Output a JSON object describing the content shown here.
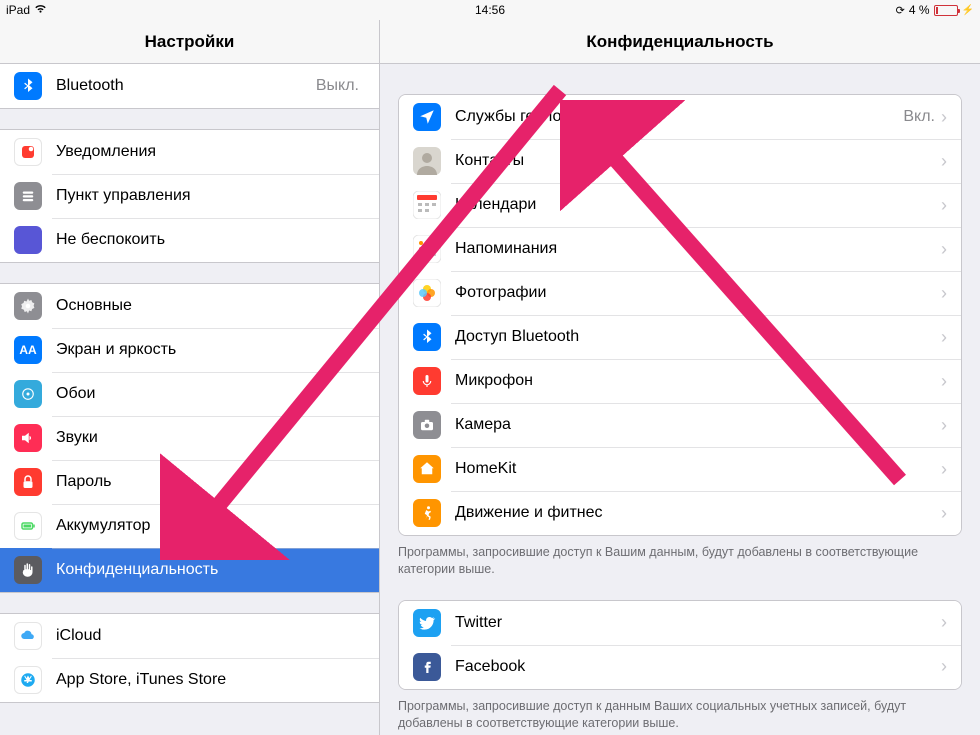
{
  "statusbar": {
    "device": "iPad",
    "time": "14:56",
    "battery_percent": "4 %"
  },
  "sidebar": {
    "title": "Настройки",
    "groups": [
      [
        {
          "id": "bluetooth",
          "label": "Bluetooth",
          "value": "Выкл."
        }
      ],
      [
        {
          "id": "notifications",
          "label": "Уведомления"
        },
        {
          "id": "control-center",
          "label": "Пункт управления"
        },
        {
          "id": "do-not-disturb",
          "label": "Не беспокоить"
        }
      ],
      [
        {
          "id": "general",
          "label": "Основные"
        },
        {
          "id": "display",
          "label": "Экран и яркость"
        },
        {
          "id": "wallpaper",
          "label": "Обои"
        },
        {
          "id": "sounds",
          "label": "Звуки"
        },
        {
          "id": "passcode",
          "label": "Пароль"
        },
        {
          "id": "battery",
          "label": "Аккумулятор"
        },
        {
          "id": "privacy",
          "label": "Конфиденциальность",
          "selected": true
        }
      ],
      [
        {
          "id": "icloud",
          "label": "iCloud"
        },
        {
          "id": "appstore",
          "label": "App Store, iTunes Store"
        }
      ]
    ]
  },
  "detail": {
    "title": "Конфиденциальность",
    "groups": [
      {
        "rows": [
          {
            "id": "location",
            "label": "Службы геолокации",
            "value": "Вкл."
          },
          {
            "id": "contacts",
            "label": "Контакты"
          },
          {
            "id": "calendars",
            "label": "Календари"
          },
          {
            "id": "reminders",
            "label": "Напоминания"
          },
          {
            "id": "photos",
            "label": "Фотографии"
          },
          {
            "id": "bt-sharing",
            "label": "Доступ Bluetooth"
          },
          {
            "id": "microphone",
            "label": "Микрофон"
          },
          {
            "id": "camera",
            "label": "Камера"
          },
          {
            "id": "homekit",
            "label": "HomeKit"
          },
          {
            "id": "motion",
            "label": "Движение и фитнес"
          }
        ],
        "footer": "Программы, запросившие доступ к Вашим данным, будут добавлены в соответствующие категории выше."
      },
      {
        "rows": [
          {
            "id": "twitter",
            "label": "Twitter"
          },
          {
            "id": "facebook",
            "label": "Facebook"
          }
        ],
        "footer": "Программы, запросившие доступ к данным Ваших социальных учетных записей, будут добавлены в соответствующие категории выше."
      }
    ]
  }
}
